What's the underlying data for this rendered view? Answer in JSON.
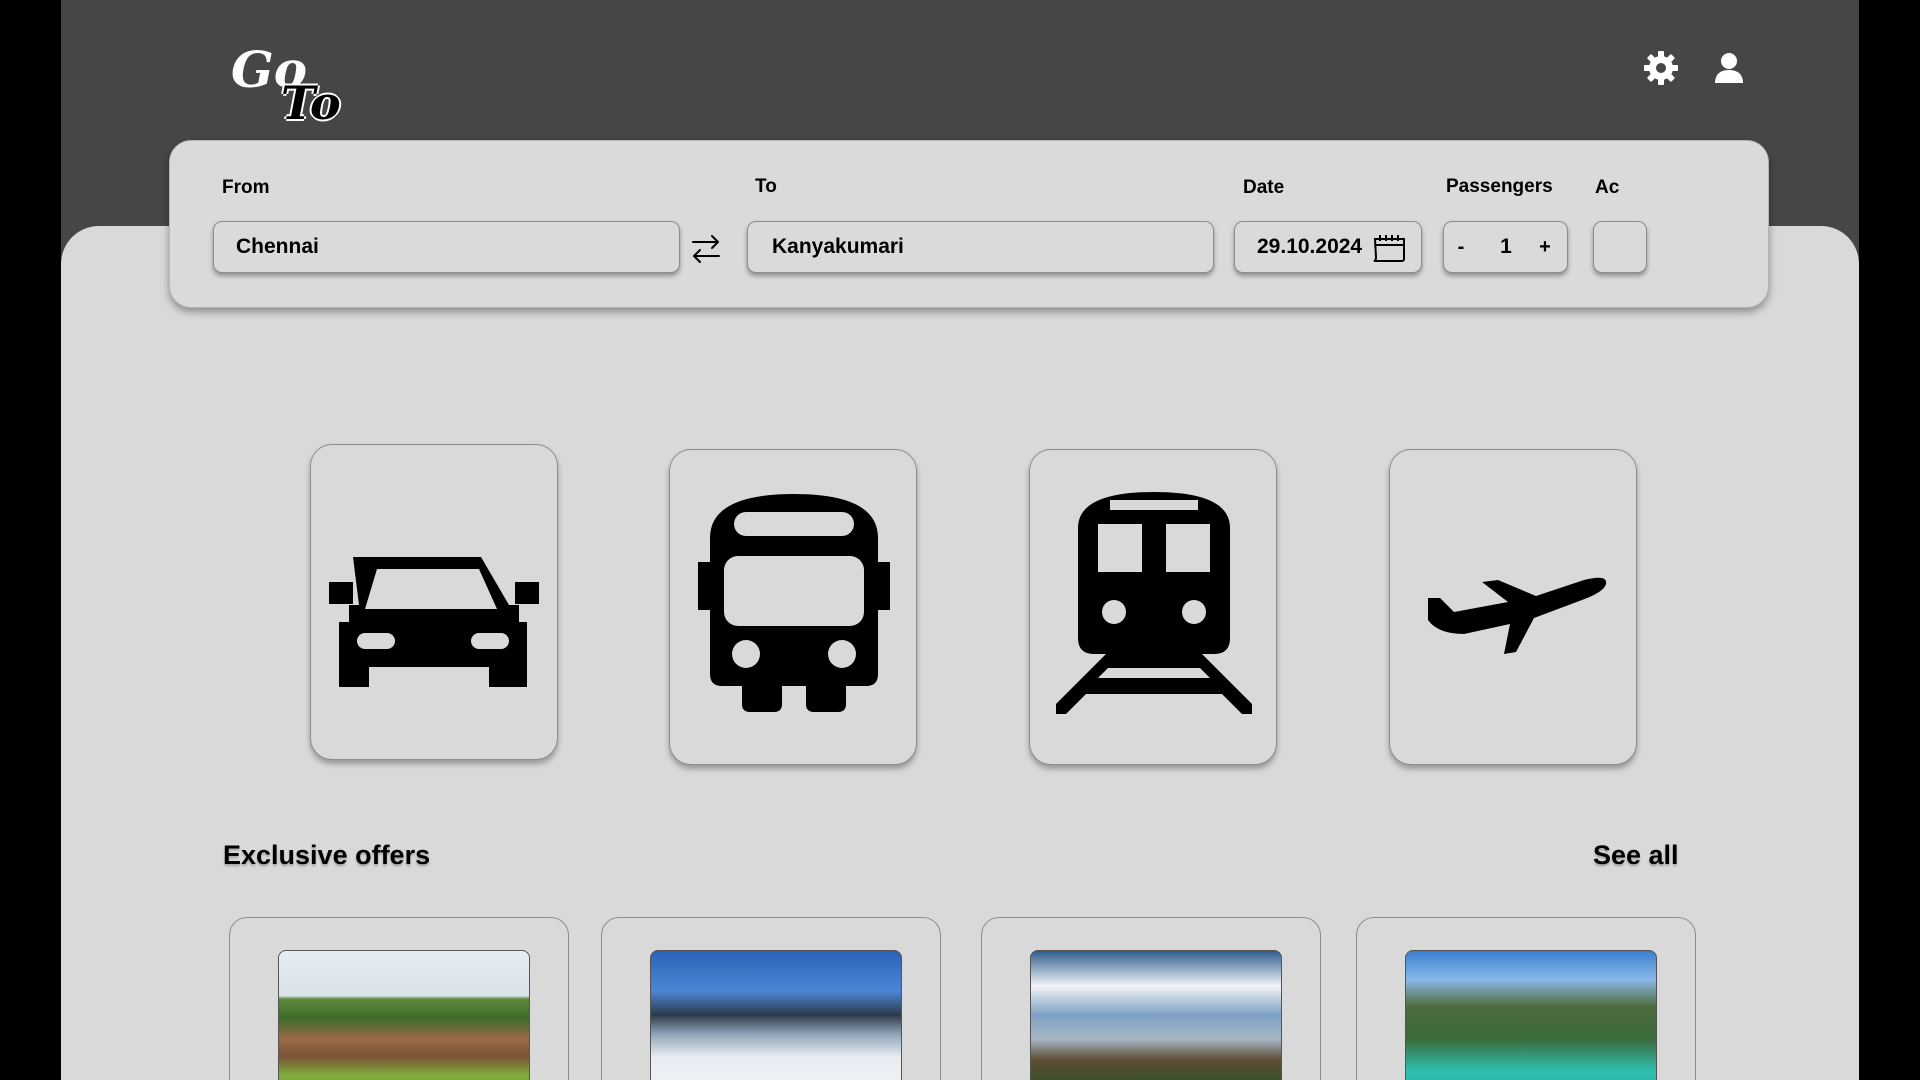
{
  "brand": {
    "logo_word_1": "Go",
    "logo_word_2": "To"
  },
  "header": {
    "settings_icon": "gear-icon",
    "profile_icon": "user-icon"
  },
  "search": {
    "from": {
      "label": "From",
      "value": "Chennai"
    },
    "to": {
      "label": "To",
      "value": "Kanyakumari"
    },
    "date": {
      "label": "Date",
      "value": "29.10.2024",
      "icon": "calendar-icon"
    },
    "passengers": {
      "label": "Passengers",
      "value": "1",
      "decrement": "-",
      "increment": "+"
    },
    "ac": {
      "label": "Ac"
    },
    "swap_icon": "swap-arrows-icon"
  },
  "modes": [
    {
      "name": "car",
      "icon": "car-icon"
    },
    {
      "name": "bus",
      "icon": "bus-icon"
    },
    {
      "name": "train",
      "icon": "train-icon"
    },
    {
      "name": "flight",
      "icon": "airplane-icon"
    }
  ],
  "offers": {
    "title": "Exclusive offers",
    "see_all": "See all",
    "items": [
      {
        "image": "ancient-temple-ruins-photo"
      },
      {
        "image": "snowy-pagoda-hill-photo"
      },
      {
        "image": "temple-reflection-lake-photo"
      },
      {
        "image": "tropical-lagoon-cliffs-photo"
      }
    ]
  },
  "colors": {
    "header_bg": "#464646",
    "content_bg": "#d9d9d9",
    "outer_bg": "#000000"
  }
}
